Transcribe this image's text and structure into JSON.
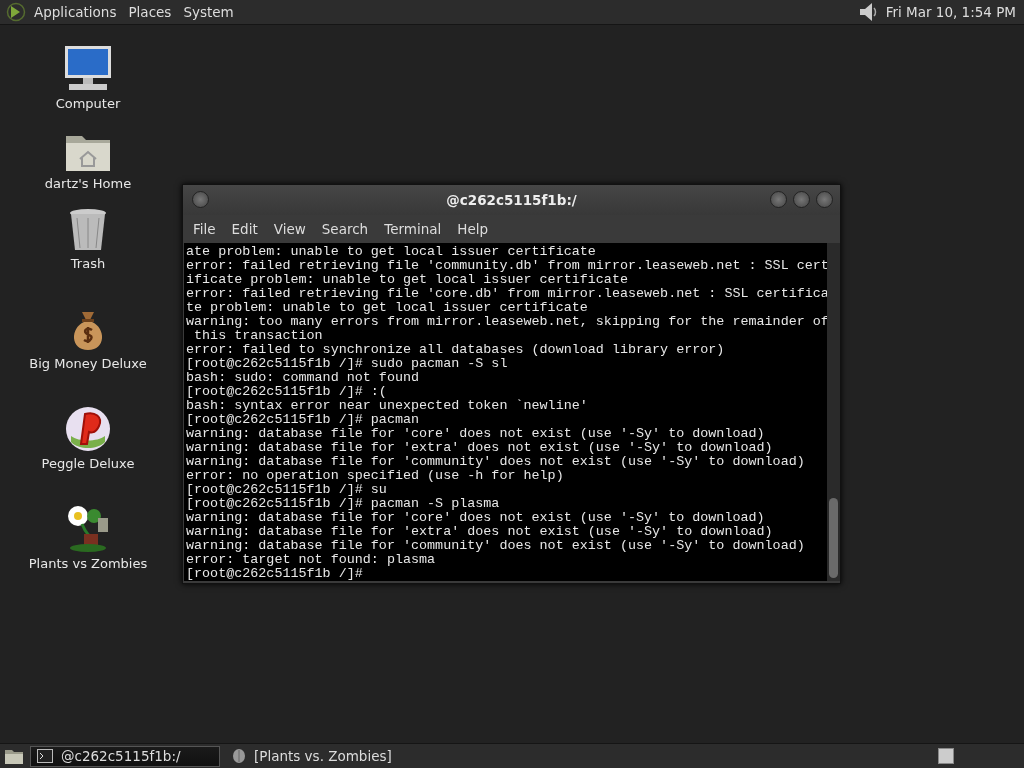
{
  "top_panel": {
    "menus": [
      "Applications",
      "Places",
      "System"
    ],
    "clock": "Fri Mar 10,  1:54 PM"
  },
  "desktop_icons": [
    {
      "kind": "computer",
      "label": "Computer"
    },
    {
      "kind": "home",
      "label": "dartz's Home"
    },
    {
      "kind": "trash",
      "label": "Trash"
    },
    {
      "kind": "moneybag",
      "label": "Big Money Deluxe"
    },
    {
      "kind": "ball",
      "label": "Peggle Deluxe"
    },
    {
      "kind": "plant",
      "label": "Plants vs Zombies"
    }
  ],
  "window": {
    "title": "@c262c5115f1b:/",
    "menu": [
      "File",
      "Edit",
      "View",
      "Search",
      "Terminal",
      "Help"
    ],
    "lines": [
      "ate problem: unable to get local issuer certificate",
      "error: failed retrieving file 'community.db' from mirror.leaseweb.net : SSL cert",
      "ificate problem: unable to get local issuer certificate",
      "error: failed retrieving file 'core.db' from mirror.leaseweb.net : SSL certifica",
      "te problem: unable to get local issuer certificate",
      "warning: too many errors from mirror.leaseweb.net, skipping for the remainder of",
      " this transaction",
      "error: failed to synchronize all databases (download library error)",
      "[root@c262c5115f1b /]# sudo pacman -S sl",
      "bash: sudo: command not found",
      "[root@c262c5115f1b /]# :(",
      "bash: syntax error near unexpected token `newline'",
      "[root@c262c5115f1b /]# pacman",
      "warning: database file for 'core' does not exist (use '-Sy' to download)",
      "warning: database file for 'extra' does not exist (use '-Sy' to download)",
      "warning: database file for 'community' does not exist (use '-Sy' to download)",
      "error: no operation specified (use -h for help)",
      "[root@c262c5115f1b /]# su",
      "[root@c262c5115f1b /]# pacman -S plasma",
      "warning: database file for 'core' does not exist (use '-Sy' to download)",
      "warning: database file for 'extra' does not exist (use '-Sy' to download)",
      "warning: database file for 'community' does not exist (use '-Sy' to download)",
      "error: target not found: plasma",
      "[root@c262c5115f1b /]#"
    ]
  },
  "taskbar": [
    {
      "kind": "terminal",
      "label": "@c262c5115f1b:/",
      "selected": true
    },
    {
      "kind": "game",
      "label": "[Plants vs. Zombies]",
      "selected": false
    }
  ]
}
